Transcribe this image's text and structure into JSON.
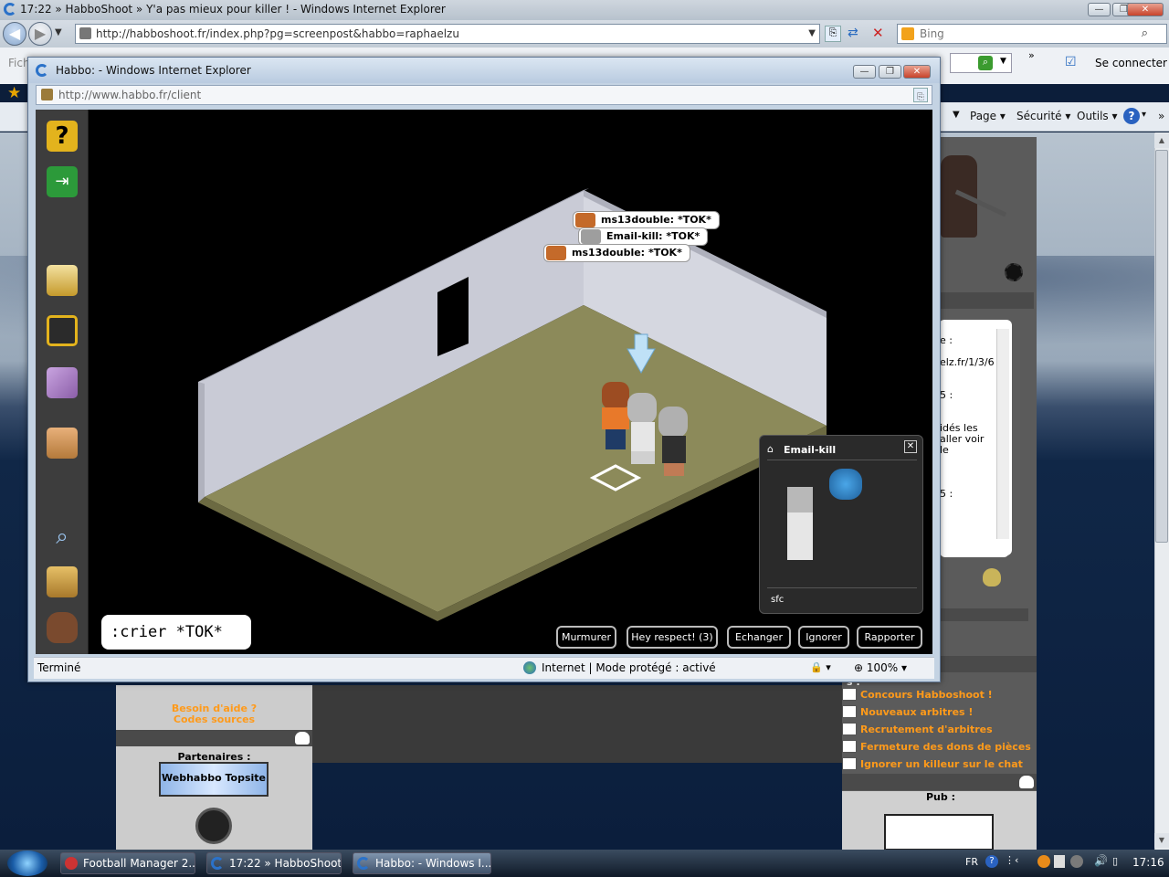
{
  "main_window": {
    "title": "17:22 » HabboShoot » Y'a pas mieux pour killer ! - Windows Internet Explorer",
    "url": "http://habboshoot.fr/index.php?pg=screenpost&habbo=raphaelzu",
    "search_engine": "Bing",
    "menu_fragment": "Fich",
    "connect_label": "Se connecter",
    "toolbar": {
      "page": "Page",
      "security": "Sécurité",
      "tools": "Outils"
    }
  },
  "background_page": {
    "help_link": "Besoin d'aide ?",
    "sources_link": "Codes sources",
    "partners_title": "Partenaires :",
    "partner_banner": "Webhabbo Topsite",
    "pub_title": "Pub :",
    "news_title_fragment": "s :",
    "news": [
      "Concours Habboshoot !",
      "Nouveaux arbitres !",
      "Recrutement d'arbitres",
      "Fermeture des dons de pièces",
      "Ignorer un killeur sur le chat"
    ],
    "side_text": [
      "e :",
      "elz.fr/1/3/6",
      "5 :",
      "idés les",
      "aller voir",
      "le",
      "5 :"
    ]
  },
  "popup": {
    "title": "Habbo: - Windows Internet Explorer",
    "url": "http://www.habbo.fr/client",
    "status_text": "Terminé",
    "zone_text": "Internet | Mode protégé : activé",
    "zoom": "100%"
  },
  "game": {
    "chat_bubbles": [
      {
        "user": "ms13double:",
        "text": "*TOK*"
      },
      {
        "user": "Email-kill:",
        "text": "*TOK*"
      },
      {
        "user": "ms13double:",
        "text": "*TOK*"
      }
    ],
    "chat_input": ":crier *TOK*",
    "infostand": {
      "name": "Email-kill",
      "motto": "sfc"
    },
    "buttons": [
      "Murmurer",
      "Hey respect! (3)",
      "Echanger",
      "Ignorer",
      "Rapporter"
    ]
  },
  "taskbar": {
    "tasks": [
      "Football Manager 2...",
      "17:22 » HabboShoot...",
      "Habbo: - Windows I..."
    ],
    "lang": "FR",
    "clock": "17:16"
  },
  "colors": {
    "accent_orange": "#ff9a1a",
    "floor": "#8c8a5a",
    "wall": "#c9cbd6",
    "game_bg": "#000000"
  }
}
